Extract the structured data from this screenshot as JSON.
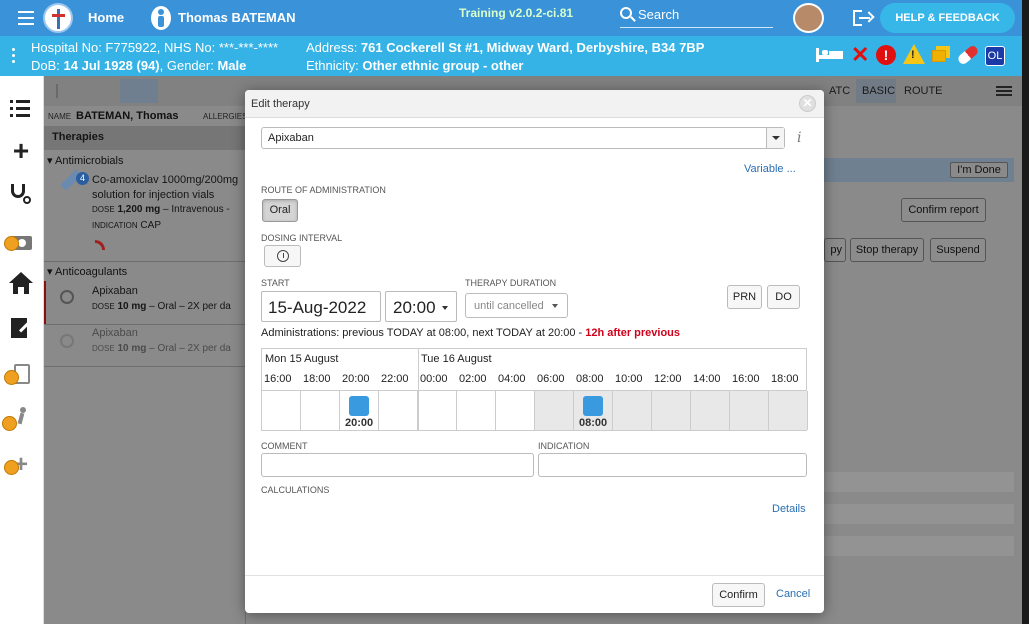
{
  "topbar": {
    "home_label": "Home",
    "patient_name": "Thomas BATEMAN",
    "version": "Training v2.0.2-ci.81",
    "search_label": "Search",
    "help_label": "HELP & FEEDBACK"
  },
  "infobar": {
    "hospital": "Hospital No: F775922, NHS No: ***-***-****",
    "dob_label": "DoB: ",
    "dob_value": "14 Jul 1928 (94)",
    "gender_label": ", Gender: ",
    "gender_value": "Male",
    "address_label": "Address: ",
    "address_value": "761 Cockerell St #1, Midway Ward, Derbyshire, B34 7BP",
    "ethnicity_label": "Ethnicity: ",
    "ethnicity_value": "Other ethnic group - other",
    "ol_badge": "OL"
  },
  "bg": {
    "name_label": "NAME",
    "name_value": "BATEMAN, Thomas",
    "allergies_label": "ALLERGIES",
    "therapies_title": "Therapies",
    "group_antimicrobials": "Antimicrobials",
    "group_anticoagulants": "Anticoagulants",
    "item1_badge": "4",
    "item1_line1": "Co-amoxiclav 1000mg/200mg",
    "item1_line2": "solution for injection vials",
    "item1_dose_label": "DOSE",
    "item1_dose_value": "1,200 mg",
    "item1_dose_rest": " – Intravenous -",
    "item1_ind_label": "INDICATION",
    "item1_ind_value": "CAP",
    "item2_name": "Apixaban",
    "item2_dose_label": "DOSE",
    "item2_dose_value": "10 mg",
    "item2_dose_rest": " – Oral – 2X per da",
    "item3_name": "Apixaban",
    "item3_dose_label": "DOSE",
    "item3_dose_value": "10 mg",
    "item3_dose_rest": " – Oral – 2X per da",
    "toolbar_atc": "ATC",
    "toolbar_basic": "BASIC",
    "toolbar_route": "ROUTE",
    "im_done": "I'm Done",
    "confirm_report": "Confirm report",
    "py": "py",
    "stop_therapy": "Stop therapy",
    "suspend": "Suspend"
  },
  "modal": {
    "title": "Edit therapy",
    "drug": "Apixaban",
    "variable_link": "Variable ...",
    "route_label": "ROUTE OF ADMINISTRATION",
    "route_value": "Oral",
    "dosing_label": "DOSING INTERVAL",
    "start_label": "START",
    "start_date": "15-Aug-2022",
    "start_time": "20:00",
    "duration_label": "THERAPY DURATION",
    "duration_value": "until cancelled",
    "prn": "PRN",
    "do": "DO",
    "admin_text": "Administrations: previous TODAY at 08:00, next TODAY at 20:00 - ",
    "admin_warn": "12h after previous",
    "timeline": {
      "day1": "Mon 15 August",
      "day2": "Tue 16 August",
      "hours": [
        "16:00",
        "18:00",
        "20:00",
        "22:00",
        "00:00",
        "02:00",
        "04:00",
        "06:00",
        "08:00",
        "10:00",
        "12:00",
        "14:00",
        "16:00",
        "18:00"
      ],
      "dose1": "20:00",
      "dose2": "08:00"
    },
    "comment_label": "COMMENT",
    "indication_label": "INDICATION",
    "calculations_label": "CALCULATIONS",
    "details_link": "Details",
    "confirm": "Confirm",
    "cancel": "Cancel"
  },
  "colors": {
    "topbar": "#3a92d8",
    "infobar": "#36b3e6",
    "accent": "#3a9ae0",
    "warn": "#d0021b"
  }
}
